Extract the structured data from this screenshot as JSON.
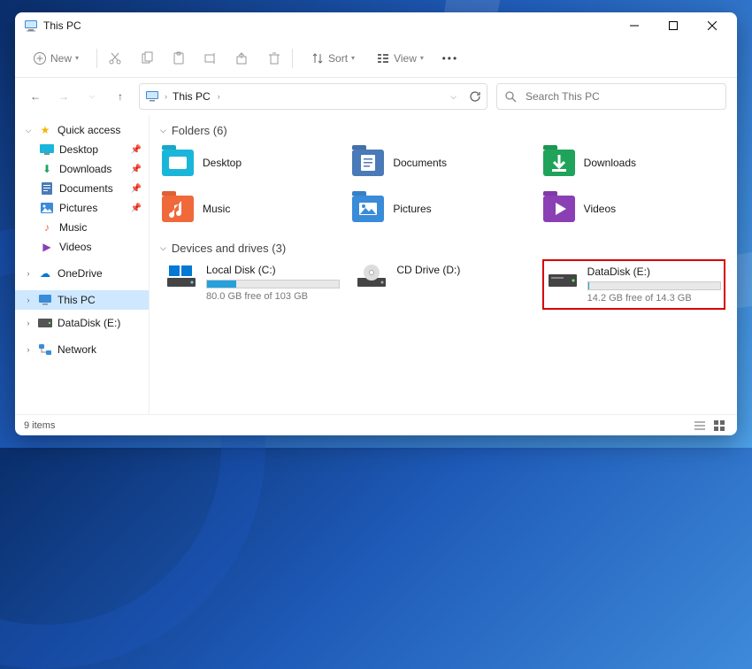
{
  "window": {
    "title": "This PC"
  },
  "toolbar": {
    "new": "New",
    "sort": "Sort",
    "view": "View"
  },
  "address": {
    "crumb": "This PC"
  },
  "search": {
    "placeholder": "Search This PC"
  },
  "sidebar": {
    "quick_access": "Quick access",
    "items": [
      {
        "label": "Desktop"
      },
      {
        "label": "Downloads"
      },
      {
        "label": "Documents"
      },
      {
        "label": "Pictures"
      },
      {
        "label": "Music"
      },
      {
        "label": "Videos"
      }
    ],
    "onedrive": "OneDrive",
    "this_pc": "This PC",
    "datadisk": "DataDisk (E:)",
    "network": "Network"
  },
  "groups": {
    "folders": {
      "label": "Folders (6)"
    },
    "drives": {
      "label": "Devices and drives (3)"
    }
  },
  "folders": [
    {
      "label": "Desktop",
      "color": "#1ab6d9"
    },
    {
      "label": "Documents",
      "color": "#4a7ab8"
    },
    {
      "label": "Downloads",
      "color": "#1fa35a"
    },
    {
      "label": "Music",
      "color": "#f0693a"
    },
    {
      "label": "Pictures",
      "color": "#3a8bd8"
    },
    {
      "label": "Videos",
      "color": "#8a3fb5"
    }
  ],
  "drives": [
    {
      "name": "Local Disk (C:)",
      "free": "80.0 GB free of 103 GB",
      "fill_pct": 22,
      "type": "win"
    },
    {
      "name": "CD Drive (D:)",
      "free": "",
      "fill_pct": null,
      "type": "cd"
    },
    {
      "name": "DataDisk (E:)",
      "free": "14.2 GB free of 14.3 GB",
      "fill_pct": 1,
      "type": "hdd",
      "highlight": true
    }
  ],
  "status": {
    "count": "9 items"
  }
}
